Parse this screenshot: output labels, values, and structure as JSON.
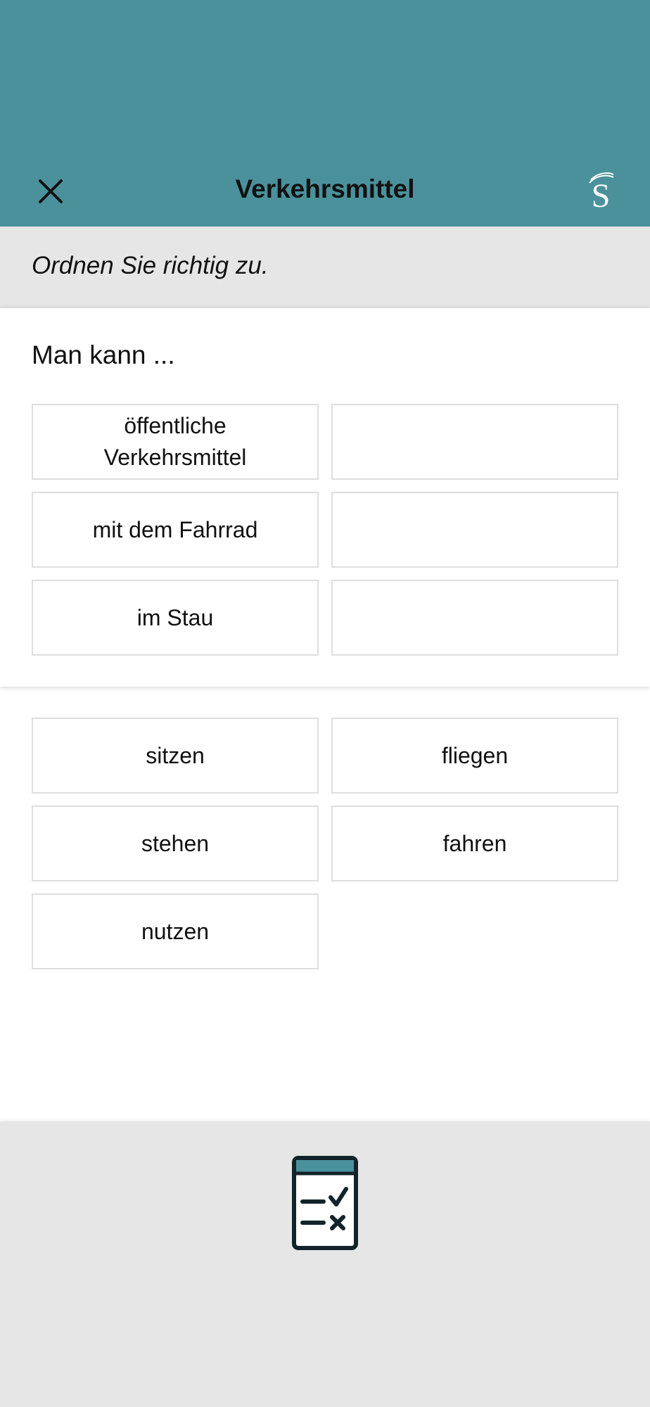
{
  "header": {
    "title": "Verkehrsmittel",
    "close_icon": "close-icon",
    "logo_letter": "S",
    "background": "#4a919c"
  },
  "instruction": "Ordnen Sie richtig zu.",
  "task": {
    "prompt": "Man kann ...",
    "pairs": [
      {
        "phrase": "öffentliche Verkehrsmittel",
        "answer": ""
      },
      {
        "phrase": "mit dem Fahrrad",
        "answer": ""
      },
      {
        "phrase": "im Stau",
        "answer": ""
      }
    ]
  },
  "word_bank": [
    "sitzen",
    "fliegen",
    "stehen",
    "fahren",
    "nutzen"
  ],
  "footer": {
    "check_icon": "checklist-icon",
    "accent": "#4a919c"
  }
}
